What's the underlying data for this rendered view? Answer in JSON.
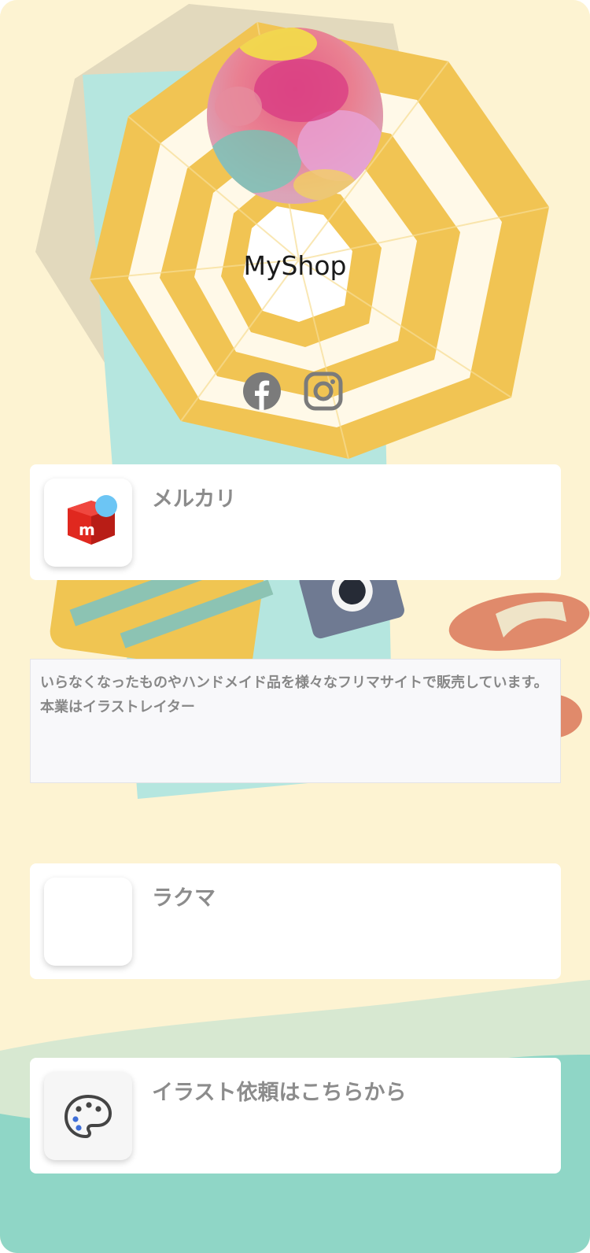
{
  "profile": {
    "shop_name": "MyShop"
  },
  "social": [
    {
      "icon": "facebook-icon"
    },
    {
      "icon": "instagram-icon"
    }
  ],
  "links": [
    {
      "title": "メルカリ",
      "icon": "mercari-logo-icon"
    },
    {
      "title": "ラクマ",
      "icon": ""
    },
    {
      "title": "イラスト依頼はこちらから",
      "icon": "palette-icon"
    }
  ],
  "description": "いらなくなったものやハンドメイド品を様々なフリマサイトで販売しています。 本業はイラストレイター",
  "colors": {
    "background": "#fdf3d2",
    "umbrella": "#f0c552",
    "towel": "#b5e6df",
    "sea": "#8fd6c6",
    "card_text": "#8c8c8c",
    "mercari_red": "#e0281f"
  }
}
